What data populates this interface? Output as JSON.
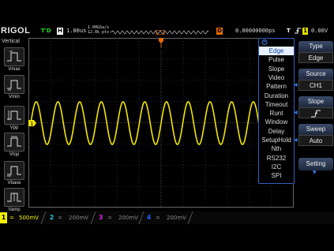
{
  "header": {
    "brand": "RIGOL",
    "run_status": "T'D",
    "h_label": "H",
    "timebase": "1.00us",
    "sample_rate": "1.00GSa/s",
    "mem_depth": "12.0k pts",
    "trig_d_label": "D",
    "trig_position": "0.00000000ps",
    "trig_t_label": "T",
    "trig_source_num": "1",
    "trig_level": "0.00V"
  },
  "left_panel": {
    "title": "Vertical",
    "items": [
      {
        "label": "Vmax"
      },
      {
        "label": "Vmin"
      },
      {
        "label": "Vpp"
      },
      {
        "label": "Vtop"
      },
      {
        "label": "Vbase"
      },
      {
        "label": "Vamp"
      }
    ]
  },
  "trigger_menu": {
    "items": [
      "Edge",
      "Pulse",
      "Slope",
      "Video",
      "Pattern",
      "Duration",
      "Timeout",
      "Runt",
      "Window",
      "Delay",
      "SetupHold",
      "Nth",
      "RS232",
      "I2C",
      "SPI"
    ],
    "selected_index": 0
  },
  "right_menu": {
    "type_title": "Type",
    "type_value": "Edge",
    "source_title": "Source",
    "source_value": "CH1",
    "slope_title": "Slope",
    "sweep_title": "Sweep",
    "sweep_value": "Auto",
    "setting_title": "Setting"
  },
  "channel_bar": [
    {
      "num": "1",
      "coupling": "=",
      "scale": "500mV",
      "color": "#f0f000",
      "active": true
    },
    {
      "num": "2",
      "coupling": "=",
      "scale": "200mV",
      "color": "#20c0e0",
      "active": false
    },
    {
      "num": "3",
      "coupling": "=",
      "scale": "200mV",
      "color": "#e020e0",
      "active": false
    },
    {
      "num": "4",
      "coupling": "=",
      "scale": "200mV",
      "color": "#2060ff",
      "active": false
    }
  ],
  "waveform": {
    "channel_marker": "1",
    "trigger_marker": "T",
    "cycles_visible": 12,
    "color": "#f2e600"
  }
}
